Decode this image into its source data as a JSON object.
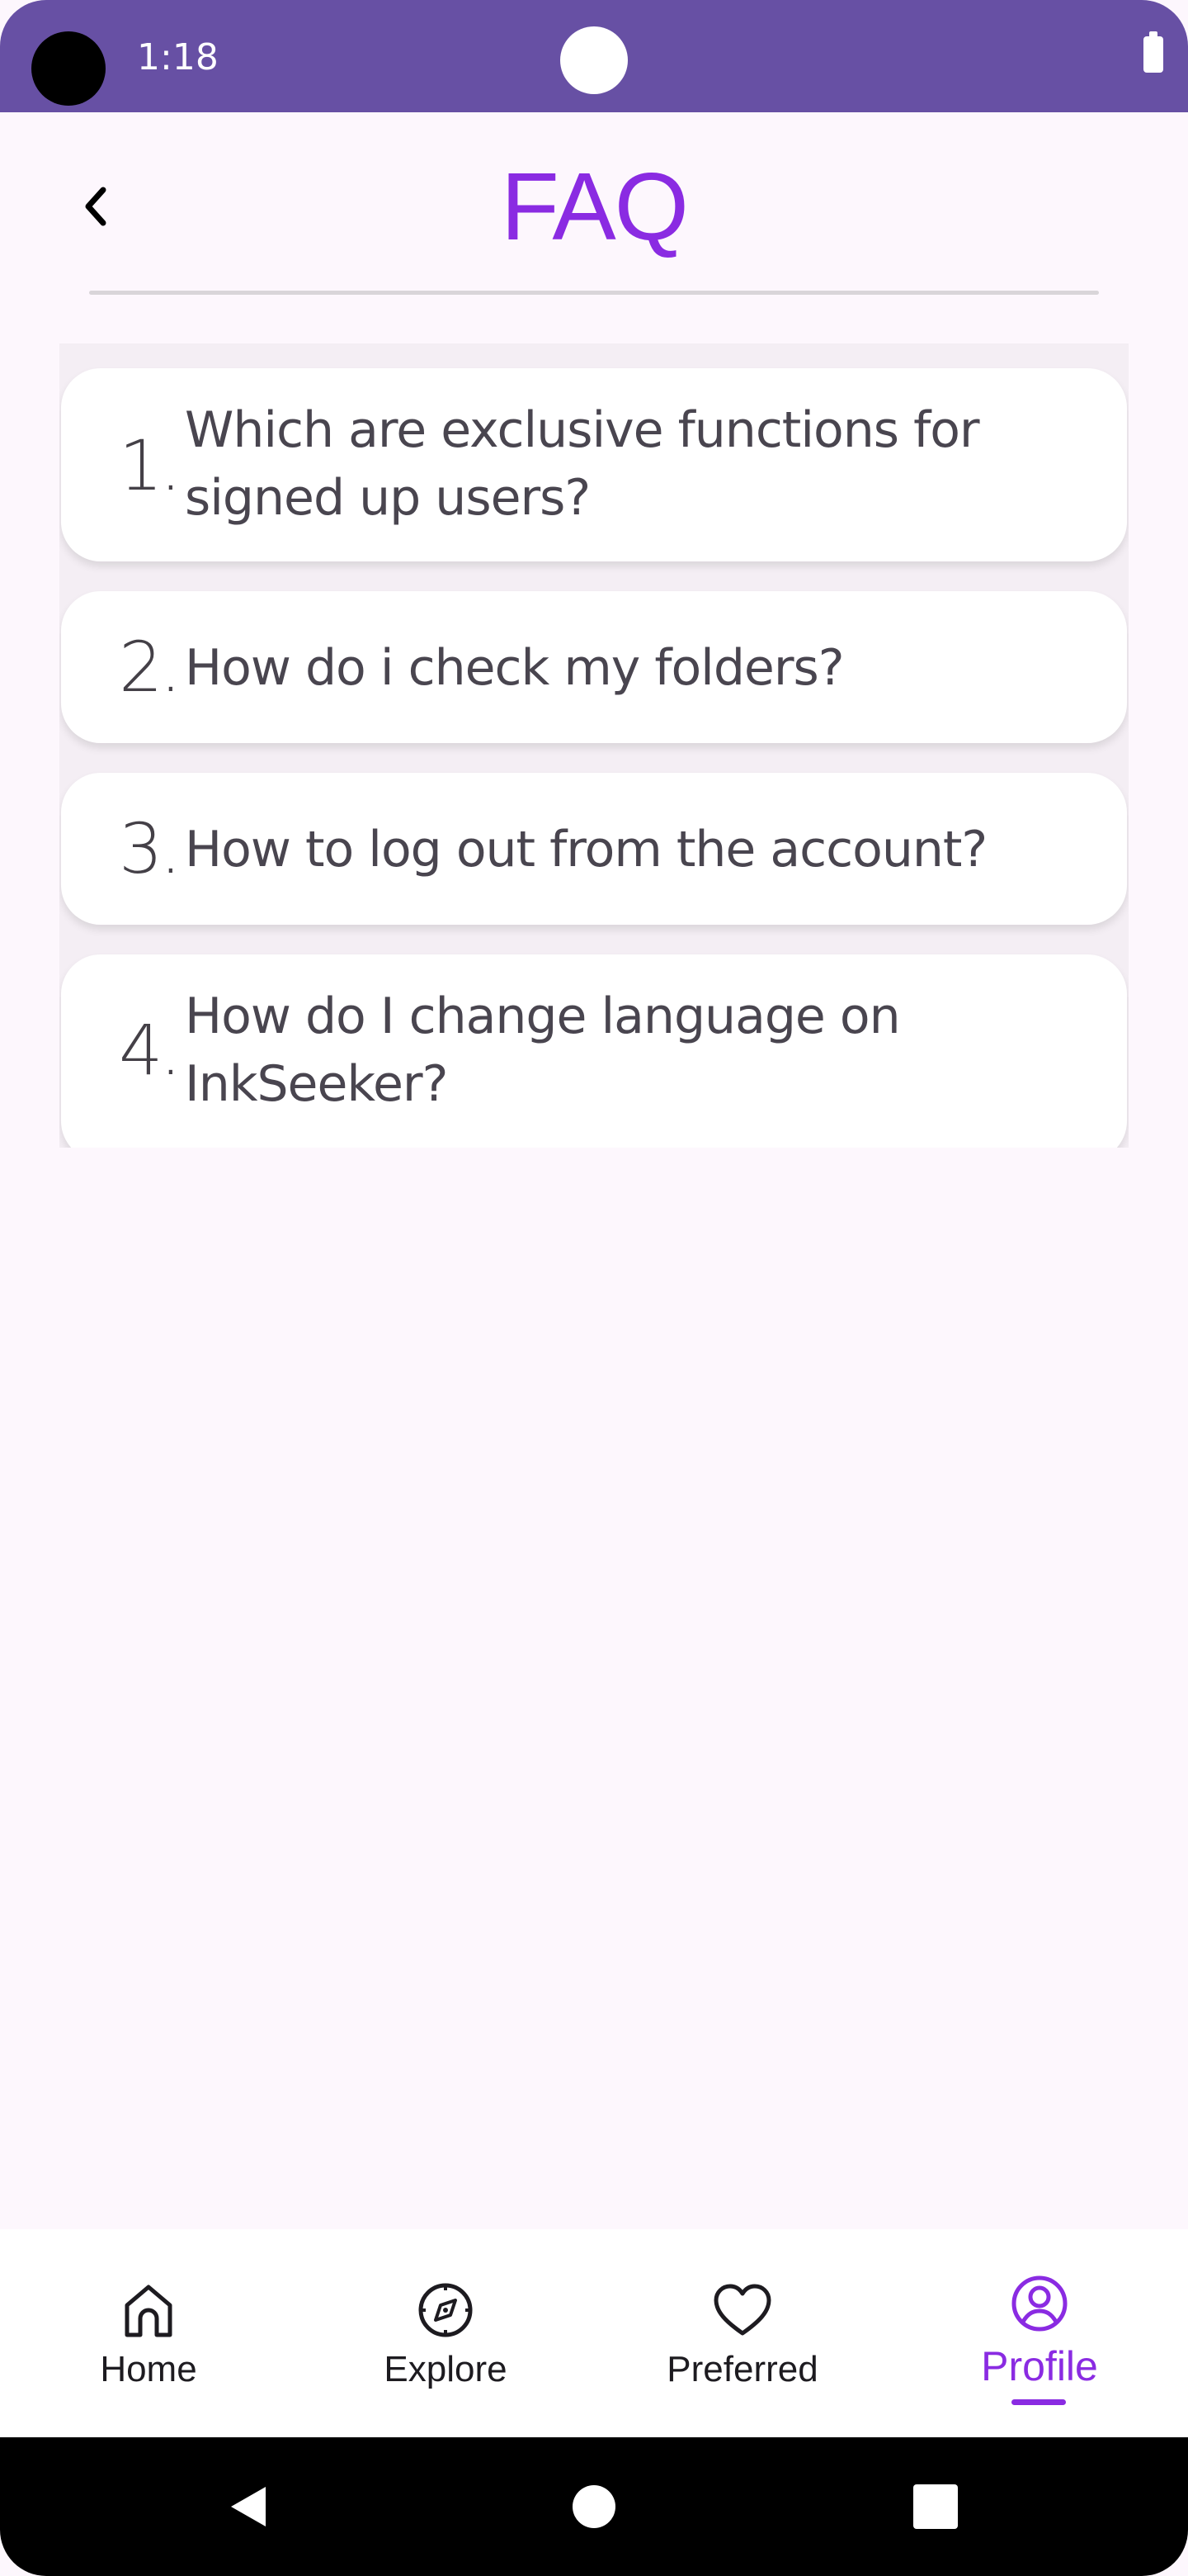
{
  "status_bar": {
    "time": "1:18"
  },
  "header": {
    "title": "FAQ",
    "back_icon": "chevron-left-icon"
  },
  "faq": {
    "items": [
      {
        "number": "1.",
        "question": "Which are exclusive functions for signed up users?"
      },
      {
        "number": "2.",
        "question": "How do i check my folders?"
      },
      {
        "number": "3.",
        "question": "How to log out from the account?"
      },
      {
        "number": "4.",
        "question": "How do I change language on InkSeeker?"
      }
    ]
  },
  "bottom_nav": {
    "items": [
      {
        "label": "Home",
        "icon": "home-icon",
        "active": false
      },
      {
        "label": "Explore",
        "icon": "compass-icon",
        "active": false
      },
      {
        "label": "Preferred",
        "icon": "heart-icon",
        "active": false
      },
      {
        "label": "Profile",
        "icon": "profile-icon",
        "active": true
      }
    ]
  },
  "colors": {
    "status_bar": "#6750a4",
    "accent": "#8a2be2",
    "background": "#fdf7fd",
    "card": "#ffffff",
    "text": "#49454f"
  }
}
